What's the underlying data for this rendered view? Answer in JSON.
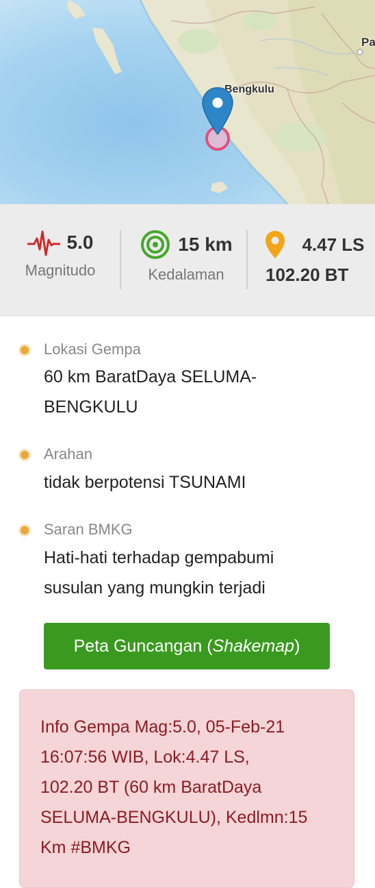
{
  "map": {
    "place_label": "Bengkulu",
    "edge_label": "Pa",
    "marker_icon": "map-pin-icon",
    "epicenter_icon": "epicenter-circle-icon"
  },
  "stats": {
    "magnitude": {
      "value": "5.0",
      "label": "Magnitudo",
      "icon": "seismograph-icon"
    },
    "depth": {
      "value": "15 km",
      "label": "Kedalaman",
      "icon": "depth-rings-icon"
    },
    "location": {
      "lat": "4.47 LS",
      "lon": "102.20 BT",
      "icon": "location-pin-icon"
    }
  },
  "info": {
    "location": {
      "title": "Lokasi Gempa",
      "line1": "60 km BaratDaya SELUMA-",
      "line2": "BENGKULU"
    },
    "direction": {
      "title": "Arahan",
      "text": "tidak berpotensi TSUNAMI"
    },
    "advice": {
      "title": "Saran BMKG",
      "line1": "Hati-hati terhadap gempabumi",
      "line2": "susulan yang mungkin terjadi"
    }
  },
  "button": {
    "prefix": "Peta Guncangan (",
    "italic": "Shakemap",
    "suffix": ")"
  },
  "alert": {
    "line1": "Info Gempa Mag:5.0, 05-Feb-21",
    "line2": "16:07:56 WIB, Lok:4.47 LS,",
    "line3": "102.20 BT (60 km BaratDaya",
    "line4": "SELUMA-BENGKULU), Kedlmn:15",
    "line5": "Km #BMKG"
  },
  "colors": {
    "accent_green": "#3a9a1f",
    "alert_text": "#8b1c22",
    "alert_bg": "#f5d5d8",
    "bullet": "#e8a93a",
    "marker_blue": "#2e86c8",
    "epicenter_pink": "#e0507e"
  }
}
